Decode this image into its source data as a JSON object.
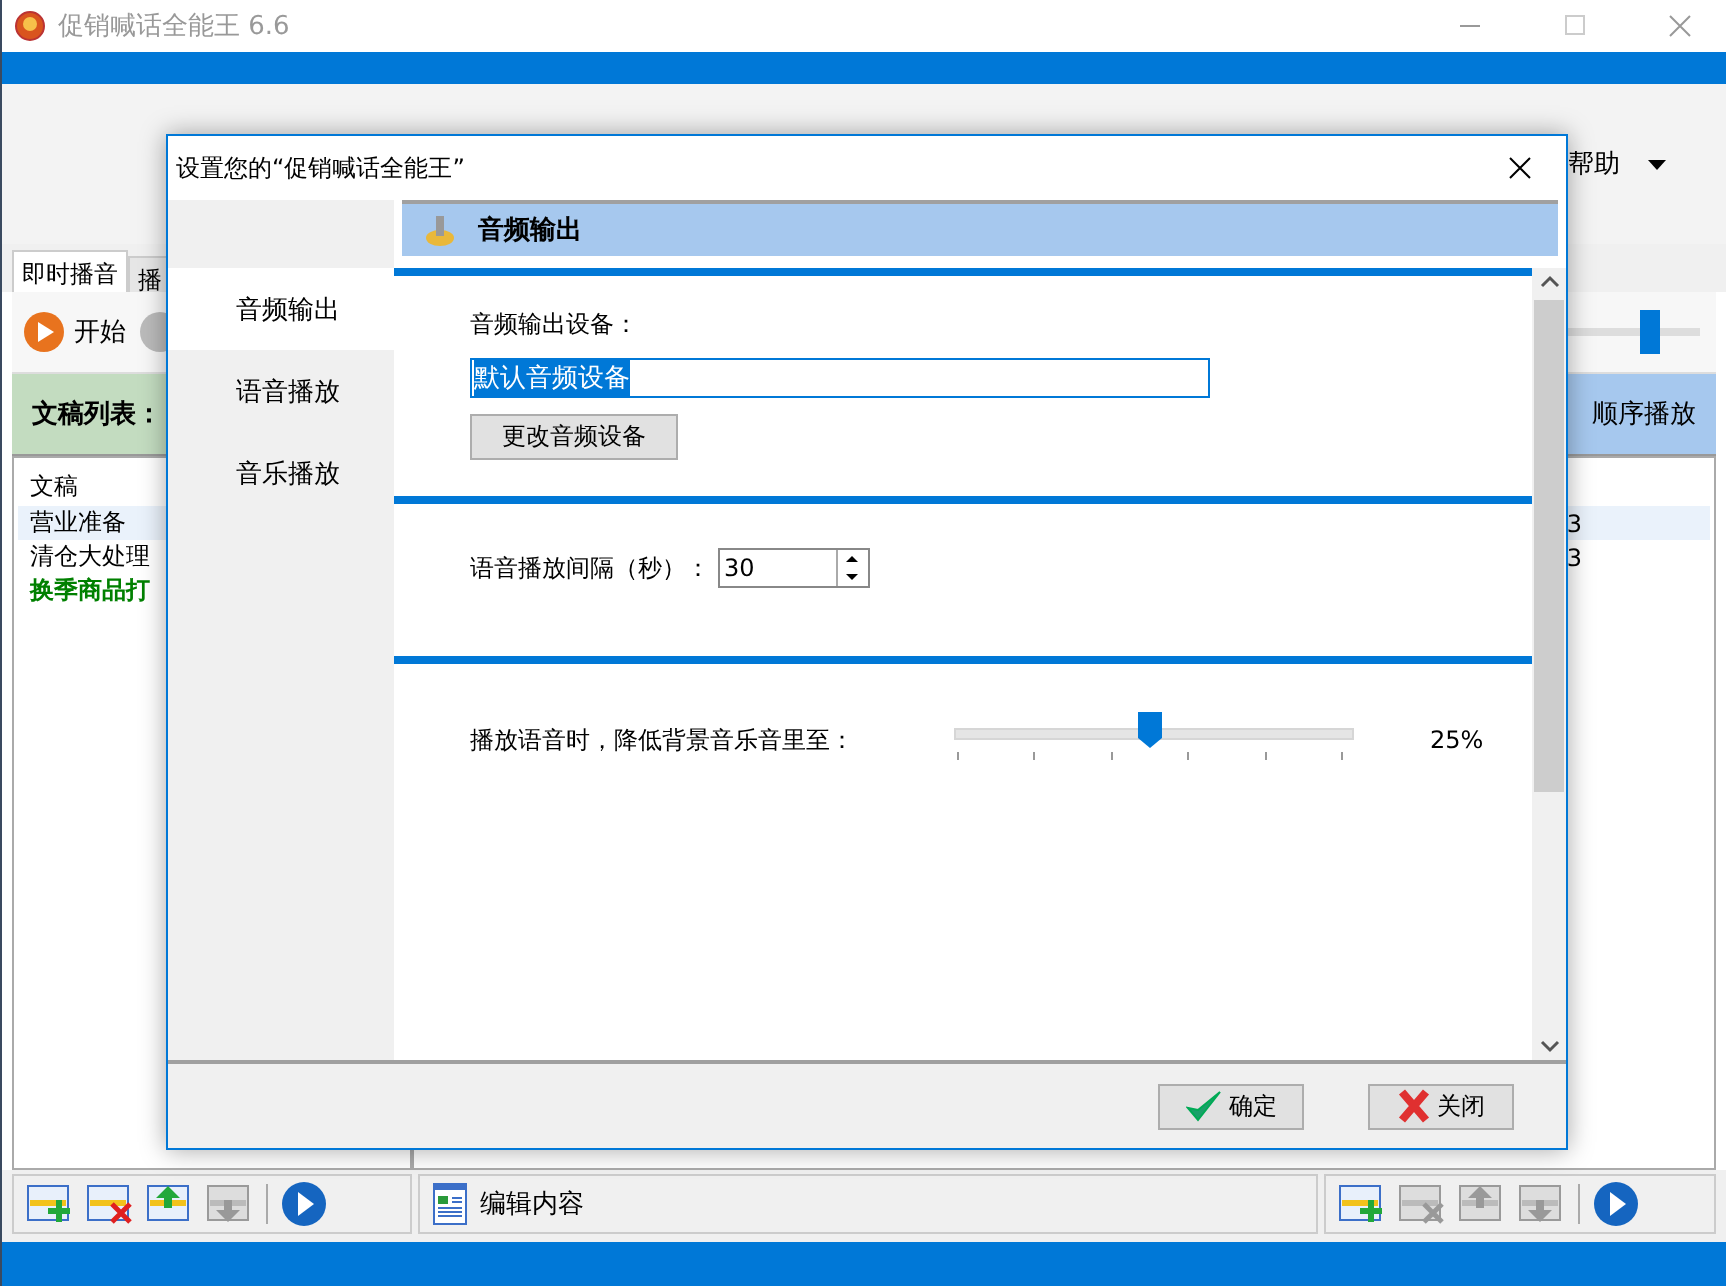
{
  "window": {
    "title": "促销喊话全能王 6.6"
  },
  "menu_item": {
    "label": "帮助"
  },
  "tabs": [
    {
      "label": "即时播音",
      "selected": true
    },
    {
      "label": "播",
      "selected": false
    }
  ],
  "toolbar": {
    "start_label": "开始"
  },
  "volume_slider": {
    "level": 0.96
  },
  "script_list": {
    "title": "文稿列表：",
    "column": "文稿",
    "rows": [
      {
        "text": "营业准备",
        "color": "#000000",
        "selected": true
      },
      {
        "text": "清仓大处理",
        "color": "#000000",
        "selected": false
      },
      {
        "text": "换季商品打",
        "color": "#008000",
        "selected": false
      }
    ]
  },
  "playlist": {
    "mode": "顺序播放",
    "rows": [
      {
        "column_2": "3",
        "selected": true
      },
      {
        "column_2": "3",
        "selected": false
      }
    ]
  },
  "left_tools": [
    {
      "kind": "add",
      "disabled": false
    },
    {
      "kind": "remove",
      "disabled": false
    },
    {
      "kind": "up",
      "disabled": false
    },
    {
      "kind": "down",
      "disabled": true
    },
    {
      "kind": "play",
      "disabled": false
    }
  ],
  "edit_label": "编辑内容",
  "right_tools": [
    {
      "kind": "add",
      "disabled": false
    },
    {
      "kind": "remove",
      "disabled": true
    },
    {
      "kind": "up",
      "disabled": true
    },
    {
      "kind": "down",
      "disabled": true
    },
    {
      "kind": "play",
      "disabled": false
    }
  ],
  "dialog": {
    "title": "设置您的“促销喊话全能王”",
    "nav": [
      {
        "label": "音频输出",
        "selected": true
      },
      {
        "label": "语音播放",
        "selected": false
      },
      {
        "label": "音乐播放",
        "selected": false
      }
    ],
    "header": "音频输出",
    "sections": [
      {
        "kind": "device",
        "label": "音频输出设备：",
        "value": "默认音频设备",
        "button": "更改音频设备"
      },
      {
        "kind": "interval",
        "label": "语音播放间隔（秒）：",
        "value": "30"
      },
      {
        "kind": "ducking",
        "label": "播放语音时，降低背景音乐音里至：",
        "level": 0.49,
        "reading": "25%"
      }
    ],
    "buttons": [
      {
        "kind": "ok",
        "label": "确定"
      },
      {
        "kind": "close",
        "label": "关闭"
      }
    ]
  }
}
